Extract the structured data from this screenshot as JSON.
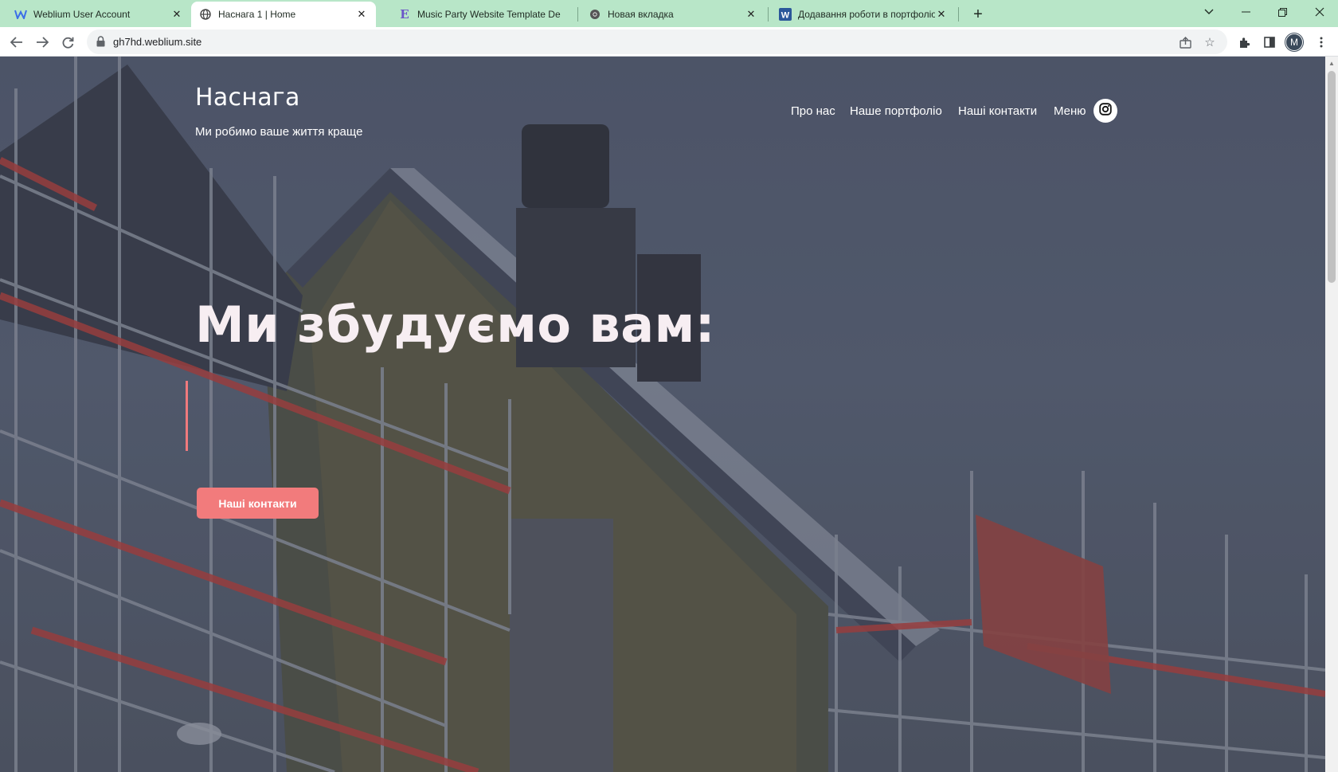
{
  "browser": {
    "tabs": [
      {
        "title": "Weblium User Account",
        "icon": "weblium-icon",
        "active": false
      },
      {
        "title": "Наснага 1 | Home",
        "icon": "globe-icon",
        "active": true
      },
      {
        "title": "Music Party Website Template De",
        "icon": "elementor-icon",
        "active": false
      },
      {
        "title": "Новая вкладка",
        "icon": "chrome-icon",
        "active": false
      },
      {
        "title": "Додавання роботи в портфоліо",
        "icon": "word-icon",
        "active": false
      }
    ],
    "url": "gh7hd.weblium.site",
    "profile_initial": "M"
  },
  "site": {
    "logo": "Наснага",
    "tagline": "Ми робимо ваше життя краще",
    "nav": [
      "Про нас",
      "Наше портфоліо",
      "Наші контакти",
      "Меню"
    ],
    "social_icon": "instagram-icon",
    "headline": "Ми збудуємо вам:",
    "cta_label": "Наші контакти"
  },
  "colors": {
    "tabbar": "#b8e6c8",
    "accent": "#f27b7c"
  }
}
